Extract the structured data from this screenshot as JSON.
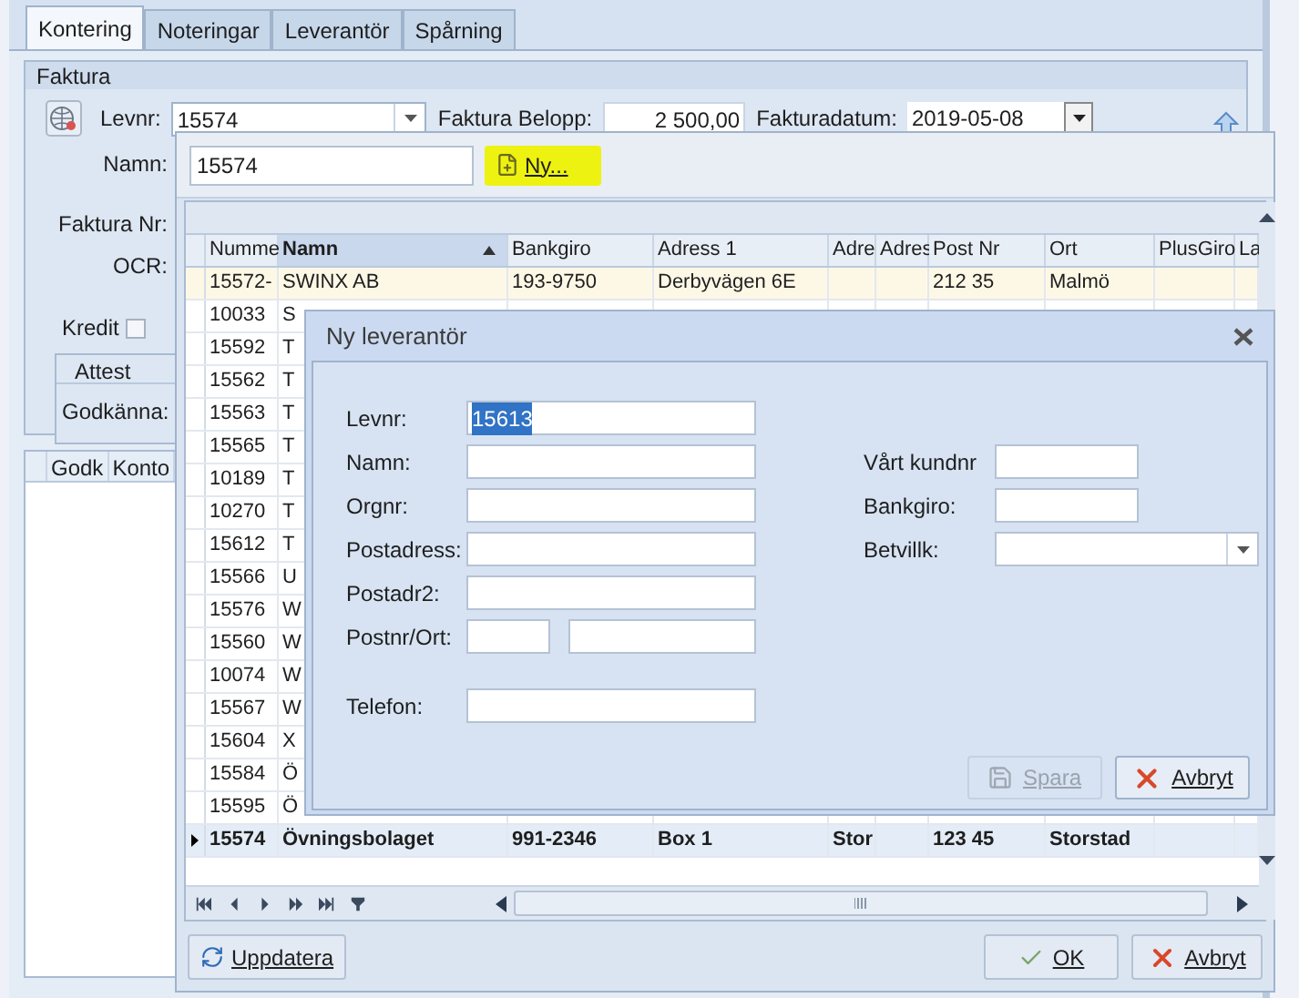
{
  "tabs": [
    {
      "label": "Kontering",
      "selected": true
    },
    {
      "label": "Noteringar",
      "selected": false
    },
    {
      "label": "Leverantör",
      "selected": false
    },
    {
      "label": "Spårning",
      "selected": false
    }
  ],
  "faktura": {
    "title": "Faktura",
    "levnr_label": "Levnr:",
    "levnr": "15574",
    "belopp_label": "Faktura Belopp:",
    "belopp": "2 500,00",
    "datum_label": "Fakturadatum:",
    "datum": "2019-05-08",
    "namn_label": "Namn:",
    "faktura_nr_label": "Faktura Nr:",
    "ocr_label": "OCR:",
    "kredit": {
      "label": "Kredit",
      "checked": false
    },
    "attest": {
      "title": "Attest",
      "godkanna_label": "Godkänna:"
    }
  },
  "lines_table": {
    "columns": [
      "Godk",
      "Konto"
    ]
  },
  "lookup": {
    "search": "15574",
    "new_button": {
      "label": "Ny...",
      "highlighted": true
    },
    "columns": [
      {
        "label": "Numme",
        "sorted": false
      },
      {
        "label": "Namn",
        "sorted": true
      },
      {
        "label": "Bankgiro",
        "sorted": false
      },
      {
        "label": "Adress 1",
        "sorted": false
      },
      {
        "label": "Adre",
        "sorted": false
      },
      {
        "label": "Adres",
        "sorted": false
      },
      {
        "label": "Post Nr",
        "sorted": false
      },
      {
        "label": "Ort",
        "sorted": false
      },
      {
        "label": "PlusGiro",
        "sorted": false
      },
      {
        "label": "La",
        "sorted": false
      }
    ],
    "rows": [
      {
        "numme": "15572-",
        "namn": "SWINX AB",
        "bankgiro": "193-9750",
        "adress_1": "Derbyvägen 6E",
        "post_nr": "212 35",
        "ort": "Malmö",
        "selected": false,
        "focused": true
      },
      {
        "numme": "10033",
        "namn": "S",
        "selected": false,
        "focused": false
      },
      {
        "numme": "15592",
        "namn": "T",
        "selected": false,
        "focused": false
      },
      {
        "numme": "15562",
        "namn": "T",
        "selected": false,
        "focused": false
      },
      {
        "numme": "15563",
        "namn": "T",
        "selected": false,
        "focused": false
      },
      {
        "numme": "15565",
        "namn": "T",
        "selected": false,
        "focused": false
      },
      {
        "numme": "10189",
        "namn": "T",
        "selected": false,
        "focused": false
      },
      {
        "numme": "10270",
        "namn": "T",
        "selected": false,
        "focused": false
      },
      {
        "numme": "15612",
        "namn": "T",
        "selected": false,
        "focused": false
      },
      {
        "numme": "15566",
        "namn": "U",
        "selected": false,
        "focused": false
      },
      {
        "numme": "15576",
        "namn": "W",
        "selected": false,
        "focused": false
      },
      {
        "numme": "15560",
        "namn": "W",
        "selected": false,
        "focused": false
      },
      {
        "numme": "10074",
        "namn": "W",
        "selected": false,
        "focused": false
      },
      {
        "numme": "15567",
        "namn": "W",
        "selected": false,
        "focused": false
      },
      {
        "numme": "15604",
        "namn": "X",
        "selected": false,
        "focused": false
      },
      {
        "numme": "15584",
        "namn": "Ö",
        "selected": false,
        "focused": false
      },
      {
        "numme": "15595",
        "namn": "Ö",
        "selected": false,
        "focused": false
      },
      {
        "numme": "15574",
        "namn": "Övningsbolaget",
        "bankgiro": "991-2346",
        "adress_1": "Box 1",
        "adre": "Stor",
        "post_nr": "123 45",
        "ort": "Storstad",
        "selected": true,
        "focused": false
      }
    ],
    "refresh_button": "Uppdatera",
    "ok_button": "OK",
    "cancel_button": "Avbryt"
  },
  "dialog": {
    "title": "Ny leverantör",
    "left_fields": [
      {
        "label": "Levnr:",
        "kind": "text",
        "value": "15613",
        "value_selected": true
      },
      {
        "label": "Namn:",
        "kind": "text"
      },
      {
        "label": "Orgnr:",
        "kind": "text"
      },
      {
        "label": "Postadress:",
        "kind": "text"
      },
      {
        "label": "Postadr2:",
        "kind": "text"
      },
      {
        "label": "Postnr/Ort:",
        "kind": "pair"
      },
      {
        "label": "Telefon:",
        "kind": "text"
      }
    ],
    "right_fields": [
      {
        "label": "Vårt kundnr",
        "kind": "text"
      },
      {
        "label": "Bankgiro:",
        "kind": "text"
      },
      {
        "label": "Betvillk:",
        "kind": "combo"
      }
    ],
    "buttons": [
      {
        "label": "Spara",
        "kind": "save",
        "disabled": true
      },
      {
        "label": "Avbryt",
        "kind": "cancel",
        "disabled": false
      }
    ]
  }
}
